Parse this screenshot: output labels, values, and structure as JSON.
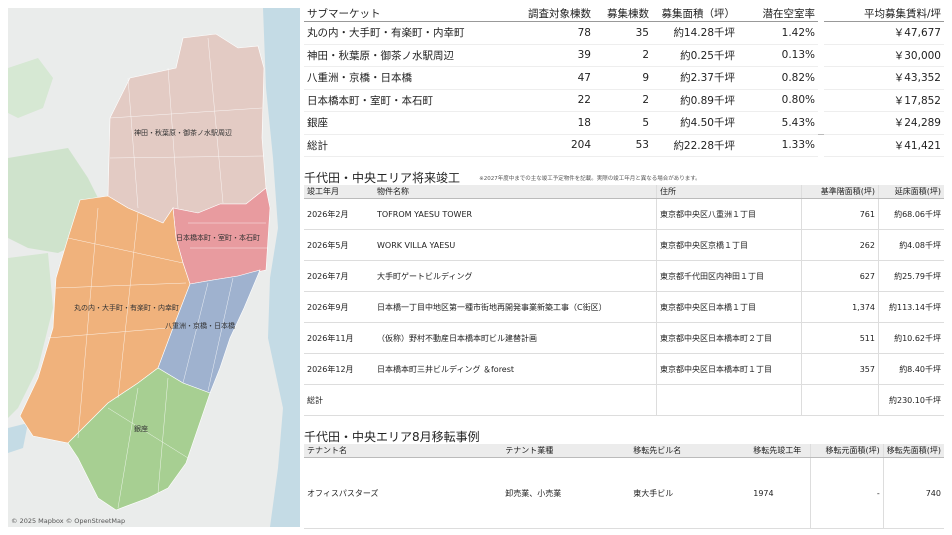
{
  "map": {
    "labels": {
      "kanda": "神田・秋葉原・御茶ノ水駅周辺",
      "nihonbashi": "日本橋本町・室町・本石町",
      "marunouchi": "丸の内・大手町・有楽町・内幸町",
      "yaesu": "八重洲・京橋・日本橋",
      "ginza": "銀座"
    },
    "attribution": "© 2025 Mapbox © OpenStreetMap",
    "colors": {
      "kanda": "#e3cbc4",
      "nihonbashi": "#e89b9f",
      "marunouchi": "#f0b27c",
      "yaesu": "#9fb2cf",
      "ginza": "#a7cf92",
      "water": "#c4dbe5",
      "park": "#cfe3cc",
      "land": "#eaeceb"
    }
  },
  "summary": {
    "headers": [
      "サブマーケット",
      "調査対象棟数",
      "募集棟数",
      "募集面積（坪）",
      "潜在空室率",
      "平均募集賃料/坪"
    ],
    "rows": [
      [
        "丸の内・大手町・有楽町・内幸町",
        "78",
        "35",
        "約14.28千坪",
        "1.42%",
        "￥47,677"
      ],
      [
        "神田・秋葉原・御茶ノ水駅周辺",
        "39",
        "2",
        "約0.25千坪",
        "0.13%",
        "￥30,000"
      ],
      [
        "八重洲・京橋・日本橋",
        "47",
        "9",
        "約2.37千坪",
        "0.82%",
        "￥43,352"
      ],
      [
        "日本橋本町・室町・本石町",
        "22",
        "2",
        "約0.89千坪",
        "0.80%",
        "￥17,852"
      ],
      [
        "銀座",
        "18",
        "5",
        "約4.50千坪",
        "5.43%",
        "￥24,289"
      ],
      [
        "総計",
        "204",
        "53",
        "約22.28千坪",
        "1.33%",
        "￥41,421"
      ]
    ]
  },
  "future": {
    "title": "千代田・中央エリア将来竣工",
    "note": "※2027年度中までの主な竣工予定物件を記載。実際の竣工年月と異なる場合があります。",
    "headers": [
      "竣工年月",
      "物件名称",
      "住所",
      "基準階面積(坪)",
      "延床面積(坪)"
    ],
    "rows": [
      [
        "2026年2月",
        "TOFROM YAESU TOWER",
        "東京都中央区八重洲１丁目",
        "761",
        "約68.06千坪"
      ],
      [
        "2026年5月",
        "WORK VILLA YAESU",
        "東京都中央区京橋１丁目",
        "262",
        "約4.08千坪"
      ],
      [
        "2026年7月",
        "大手町ゲートビルディング",
        "東京都千代田区内神田１丁目",
        "627",
        "約25.79千坪"
      ],
      [
        "2026年9月",
        "日本橋一丁目中地区第一種市街地再開発事業新築工事（C街区）",
        "東京都中央区日本橋１丁目",
        "1,374",
        "約113.14千坪"
      ],
      [
        "2026年11月",
        "（仮称）野村不動産日本橋本町ビル建替計画",
        "東京都中央区日本橋本町２丁目",
        "511",
        "約10.62千坪"
      ],
      [
        "2026年12月",
        "日本橋本町三井ビルディング ＆forest",
        "東京都中央区日本橋本町１丁目",
        "357",
        "約8.40千坪"
      ],
      [
        "総計",
        "",
        "",
        "",
        "約230.10千坪"
      ]
    ]
  },
  "move": {
    "title": "千代田・中央エリア8月移転事例",
    "headers": [
      "テナント名",
      "テナント業種",
      "移転先ビル名",
      "移転先竣工年",
      "移転元面積(坪)",
      "移転先面積(坪)"
    ],
    "rows": [
      [
        "オフィスパスターズ",
        "卸売業、小売業",
        "東大手ビル",
        "1974",
        "-",
        "740"
      ]
    ]
  }
}
